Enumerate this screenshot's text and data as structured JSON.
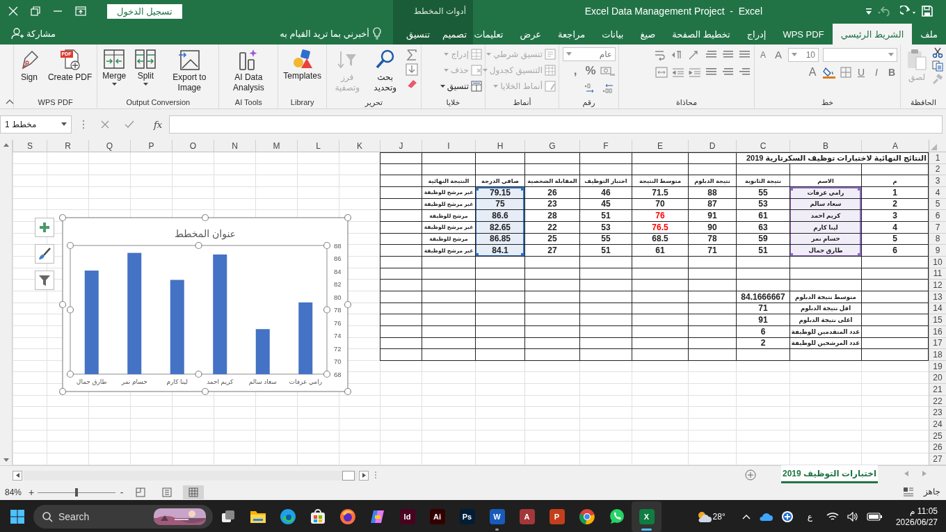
{
  "window": {
    "title": "Excel Data Management Project  -  Excel",
    "sign_in": "تسجيل الدخول"
  },
  "tabs": [
    {
      "label": "ملف",
      "selected": false
    },
    {
      "label": "الشريط الرئيسي",
      "selected": true
    },
    {
      "label": "WPS PDF",
      "selected": false
    },
    {
      "label": "إدراج",
      "selected": false
    },
    {
      "label": "تخطيط الصفحة",
      "selected": false
    },
    {
      "label": "صيغ",
      "selected": false
    },
    {
      "label": "بيانات",
      "selected": false
    },
    {
      "label": "مراجعة",
      "selected": false
    },
    {
      "label": "عرض",
      "selected": false
    },
    {
      "label": "تعليمات",
      "selected": false
    }
  ],
  "chart_tools": {
    "label": "أدوات المخطط",
    "tabs": [
      {
        "label": "تصميم",
        "selected": false
      },
      {
        "label": "تنسيق",
        "selected": false
      }
    ]
  },
  "tell_me": "أخبرني بما تريد القيام به",
  "share": "مشاركة",
  "ribbon": {
    "groups": [
      {
        "kind": "clipboard",
        "label": "الحافظة",
        "paste": {
          "label": "لصق",
          "disabled": true
        }
      },
      {
        "kind": "font",
        "label": "خط",
        "font_size": "10",
        "size_buttons": [
          "A",
          "A"
        ],
        "style_buttons": [
          "B",
          "I",
          "U"
        ],
        "font_color": "A"
      },
      {
        "kind": "alignment",
        "label": "محاذاة"
      },
      {
        "kind": "number",
        "label": "رقم",
        "format": "عام",
        "symbols": [
          "%",
          ","
        ]
      },
      {
        "kind": "styles",
        "label": "أنماط",
        "items": [
          {
            "label": "تنسيق شرطي",
            "disabled": true
          },
          {
            "label": "التنسيق كجدول",
            "disabled": true
          },
          {
            "label": "أنماط الخلايا",
            "disabled": true
          }
        ]
      },
      {
        "kind": "cells",
        "label": "خلايا",
        "items": [
          {
            "label": "إدراج",
            "disabled": true
          },
          {
            "label": "حذف",
            "disabled": true
          },
          {
            "label": "تنسيق",
            "disabled": false
          }
        ]
      },
      {
        "kind": "editing",
        "label": "تحرير",
        "items": [
          {
            "label": "بحث وتحديد",
            "disabled": false
          },
          {
            "label": "فرز وتصفية",
            "disabled": true
          }
        ]
      },
      {
        "kind": "tools",
        "label": "Library",
        "items": [
          {
            "kind": "templates",
            "label": "Templates",
            "menu": false
          }
        ]
      },
      {
        "kind": "tools",
        "label": "AI Tools",
        "items": [
          {
            "kind": "ai",
            "label": "AI Data Analysis",
            "menu": false
          }
        ]
      },
      {
        "kind": "tools",
        "label": "Output Conversion",
        "items": [
          {
            "kind": "export",
            "label": "Export to Image",
            "menu": false
          },
          {
            "kind": "split",
            "label": "Split",
            "menu": true
          },
          {
            "kind": "merge",
            "label": "Merge",
            "menu": true
          }
        ]
      },
      {
        "kind": "tools",
        "label": "WPS PDF",
        "items": [
          {
            "kind": "pdf",
            "label": "Create PDF",
            "badge": "PDF",
            "menu": false
          },
          {
            "kind": "sign",
            "label": "Sign",
            "menu": false
          }
        ]
      }
    ]
  },
  "formula_bar": {
    "name_box": "مخطط 1",
    "function_label": "fx"
  },
  "sheet": {
    "columns": [
      "A",
      "B",
      "C",
      "D",
      "E",
      "F",
      "G",
      "H",
      "I",
      "J",
      "K",
      "L",
      "M",
      "N",
      "O",
      "P",
      "Q",
      "R",
      "S"
    ],
    "rows": [
      "1",
      "2",
      "3",
      "4",
      "5",
      "6",
      "7",
      "8",
      "9",
      "10",
      "11",
      "12",
      "13",
      "14",
      "15",
      "16",
      "17",
      "18",
      "19",
      "20",
      "21",
      "22",
      "23",
      "24",
      "25",
      "26",
      "27"
    ],
    "cells": {
      "r1": {
        "A": "النتائج النهائية لاختبارات توظيف السكرتارية 2019"
      },
      "r3": {
        "A": "م",
        "B": "الاسم",
        "C": "نتيجة الثانوية",
        "D": "نتيجة الدبلوم",
        "E": "متوسط النتيجة",
        "F": "اختبار التوظيف",
        "G": "المقابلة الشخصية",
        "H": "صافي الدرجة",
        "I": "النتيجة النهائية"
      },
      "r4": {
        "A": "1",
        "B": "رامي عرفات",
        "C": "55",
        "D": "88",
        "E": "71.5",
        "F": "46",
        "G": "26",
        "H": "79.15",
        "I": "غير مرشح للوظيفة"
      },
      "r5": {
        "A": "2",
        "B": "سعاد سالم",
        "C": "53",
        "D": "87",
        "E": "70",
        "F": "45",
        "G": "23",
        "H": "75",
        "I": "غير مرشح للوظيفة"
      },
      "r6": {
        "A": "3",
        "B": "كريم احمد",
        "C": "61",
        "D": "91",
        "E": {
          "text": "76",
          "color": "#ff0000"
        },
        "F": "51",
        "G": "28",
        "H": "86.6",
        "I": "مرشح للوظيفة"
      },
      "r7": {
        "A": "4",
        "B": "لينا كارم",
        "C": "63",
        "D": "90",
        "E": {
          "text": "76.5",
          "color": "#ff0000"
        },
        "F": "53",
        "G": "22",
        "H": "82.65",
        "I": "غير مرشح للوظيفة"
      },
      "r8": {
        "A": "5",
        "B": "حسام نمر",
        "C": "59",
        "D": "78",
        "E": "68.5",
        "F": "55",
        "G": "25",
        "H": "86.85",
        "I": "مرشح للوظيفة"
      },
      "r9": {
        "A": "6",
        "B": "طارق جمال",
        "C": "51",
        "D": "71",
        "E": "61",
        "F": "51",
        "G": "27",
        "H": "84.1",
        "I": "غير مرشح للوظيفة"
      },
      "r13": {
        "B": "متوسط نتيجة الدبلوم",
        "C": "84.1666667"
      },
      "r14": {
        "B": "اقل نتيجة الدبلوم",
        "C": "71"
      },
      "r15": {
        "B": "اعلى نتيجة الدبلوم",
        "C": "91"
      },
      "r16": {
        "B": "عدد المتقدمين للوظيفة",
        "C": "6"
      },
      "r17": {
        "B": "عدد المرشحين للوظيفة",
        "C": "2"
      }
    },
    "highlights": [
      {
        "color": "#8e6cc4"
      },
      {
        "color": "#2f6fc0"
      }
    ],
    "chart": {
      "chart_data": {
        "type": "bar",
        "title": "عنوان المخطط",
        "categories": [
          "طارق جمال",
          "حسام نمر",
          "لينا كارم",
          "كريم احمد",
          "سعاد سالم",
          "رامي عرفات"
        ],
        "series": [
          {
            "color": "#4472c4",
            "values": [
              84.1,
              86.85,
              82.65,
              86.6,
              75,
              79.15
            ]
          }
        ],
        "ylim": [
          68,
          88
        ],
        "yticks": [
          {
            "value": 68,
            "label": "68"
          },
          {
            "value": 70,
            "label": "70"
          },
          {
            "value": 72,
            "label": "72"
          },
          {
            "value": 74,
            "label": "74"
          },
          {
            "value": 76,
            "label": "76"
          },
          {
            "value": 78,
            "label": "78"
          },
          {
            "value": 80,
            "label": "80"
          },
          {
            "value": 82,
            "label": "82"
          },
          {
            "value": 84,
            "label": "84"
          },
          {
            "value": 86,
            "label": "86"
          },
          {
            "value": 88,
            "label": "88"
          }
        ]
      }
    }
  },
  "sheet_tabs": [
    {
      "label": "اختبارات التوظيف 2019",
      "selected": true
    }
  ],
  "status_bar": {
    "ready": "جاهز",
    "zoom": "84%",
    "zoom_in": "+",
    "zoom_out": "-",
    "zoom_slider": {
      "level": 0.5
    },
    "views": [
      {
        "kind": "break",
        "selected": false
      },
      {
        "kind": "layout",
        "selected": false
      },
      {
        "kind": "normal",
        "selected": true
      }
    ]
  },
  "taskbar": {
    "search": "Search",
    "apps": [
      {
        "kind": "tile",
        "label": "X",
        "color": "#107c41",
        "running": true,
        "selected": true
      },
      {
        "kind": "whatsapp",
        "running": false,
        "selected": false
      },
      {
        "kind": "chrome",
        "running": false,
        "selected": false
      },
      {
        "kind": "tile",
        "label": "P",
        "color": "#c43e1c",
        "running": false,
        "selected": false
      },
      {
        "kind": "tile",
        "label": "A",
        "color": "#a4373a",
        "running": false,
        "selected": false
      },
      {
        "kind": "tile",
        "label": "W",
        "color": "#185abd",
        "running": true,
        "selected": false
      },
      {
        "kind": "tile",
        "label": "Ps",
        "color": "#001e36",
        "running": false,
        "selected": false
      },
      {
        "kind": "tile",
        "label": "Ai",
        "color": "#330000",
        "running": false,
        "selected": false
      },
      {
        "kind": "tile",
        "label": "Id",
        "color": "#49021f",
        "running": false,
        "selected": false
      },
      {
        "kind": "copilot",
        "running": false,
        "selected": false
      },
      {
        "kind": "firefox",
        "running": false,
        "selected": false
      },
      {
        "kind": "store",
        "running": false,
        "selected": false
      },
      {
        "kind": "edge",
        "running": false,
        "selected": false
      },
      {
        "kind": "folder",
        "running": false,
        "selected": false
      },
      {
        "kind": "taskview",
        "running": false,
        "selected": false
      }
    ],
    "weather": "28°",
    "ime": "ع",
    "time": "11:05 م",
    "date": "2026/06/27"
  }
}
